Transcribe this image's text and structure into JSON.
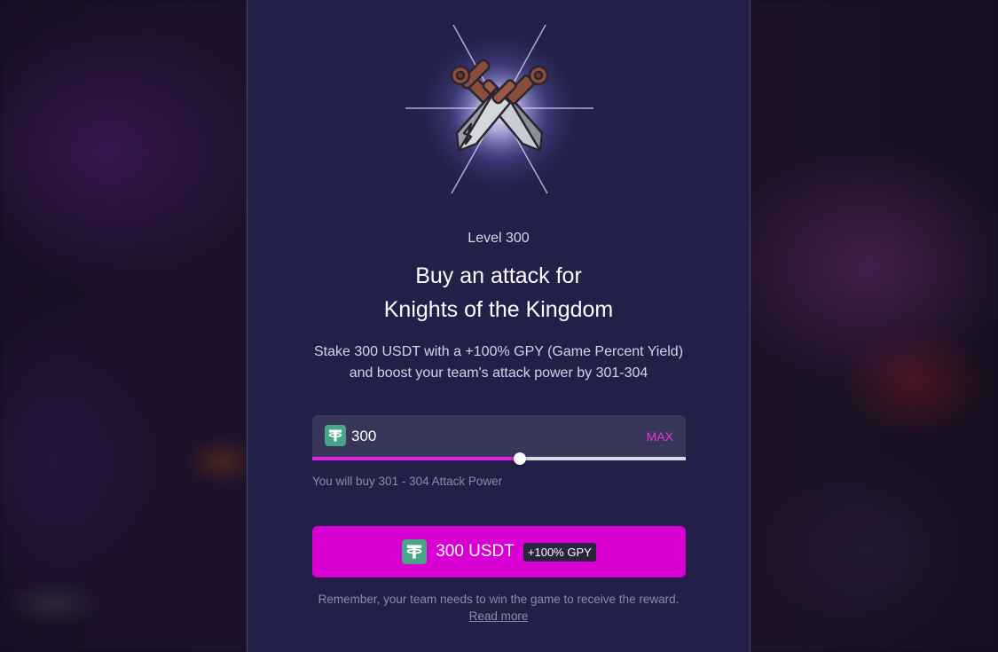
{
  "level_label": "Level 300",
  "title": {
    "line1": "Buy an attack for",
    "line2": "Knights of the Kingdom"
  },
  "description": {
    "line1": "Stake 300 USDT with a +100% GPY (Game Percent Yield)",
    "line2": "and boost your team's attack power by 301-304"
  },
  "stake_input": {
    "value": "300",
    "max_label": "MAX",
    "token_icon": "tether-icon"
  },
  "slider": {
    "fraction": 0.555
  },
  "buy_note": "You will buy 301 - 304 Attack Power",
  "buy_button": {
    "label": "300 USDT",
    "badge": "+100% GPY",
    "token_icon": "tether-icon"
  },
  "footer": {
    "note": "Remember, your team needs to win the game to receive the reward.",
    "read_more": "Read more"
  },
  "colors": {
    "accent": "#d900d3",
    "slider_fill": "#e01fe0",
    "max_text": "#e23bd9",
    "panel": "#222049",
    "token": "#49a587"
  },
  "hero_icon": "crossed-swords-icon"
}
